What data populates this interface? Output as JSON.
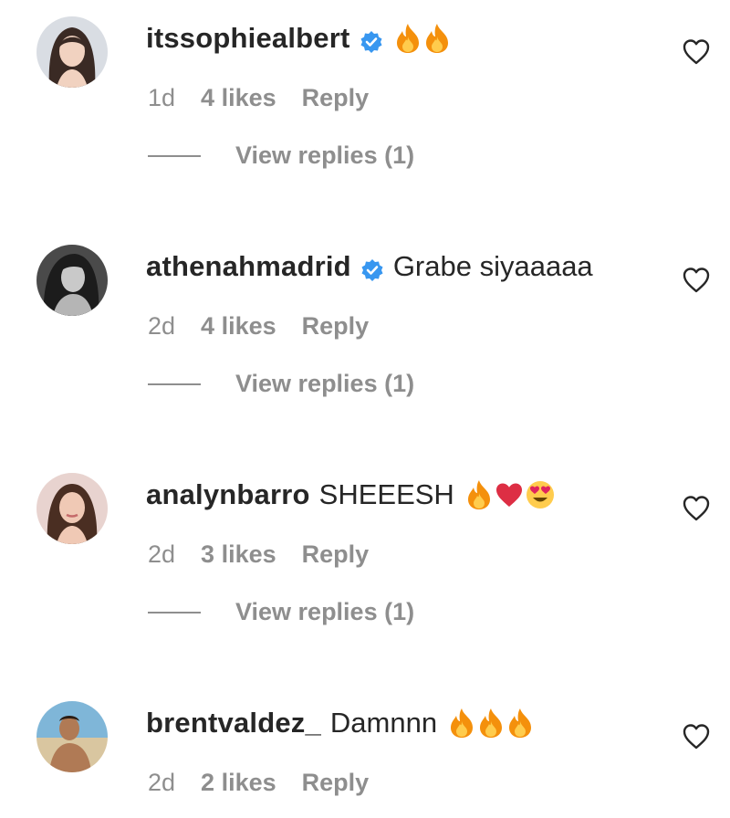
{
  "comments": [
    {
      "username": "itssophiealbert",
      "verified": true,
      "text": "",
      "emojis": [
        "fire-emoji",
        "fire-emoji"
      ],
      "time": "1d",
      "likes": "4 likes",
      "reply": "Reply",
      "view_replies": "View replies (1)"
    },
    {
      "username": "athenahmadrid",
      "verified": true,
      "text": "Grabe siyaaaaa",
      "emojis": [],
      "time": "2d",
      "likes": "4 likes",
      "reply": "Reply",
      "view_replies": "View replies (1)"
    },
    {
      "username": "analynbarro",
      "verified": false,
      "text": "SHEEESH",
      "emojis": [
        "fire-emoji",
        "red-heart-emoji",
        "heart-eyes-emoji"
      ],
      "time": "2d",
      "likes": "3 likes",
      "reply": "Reply",
      "view_replies": "View replies (1)"
    },
    {
      "username": "brentvaldez_",
      "verified": false,
      "text": "Damnnn",
      "emojis": [
        "fire-emoji",
        "fire-emoji",
        "fire-emoji"
      ],
      "time": "2d",
      "likes": "2 likes",
      "reply": "Reply",
      "view_replies": ""
    }
  ],
  "colors": {
    "text": "#262626",
    "secondary": "#8e8e8e",
    "verified": "#3897f0"
  }
}
